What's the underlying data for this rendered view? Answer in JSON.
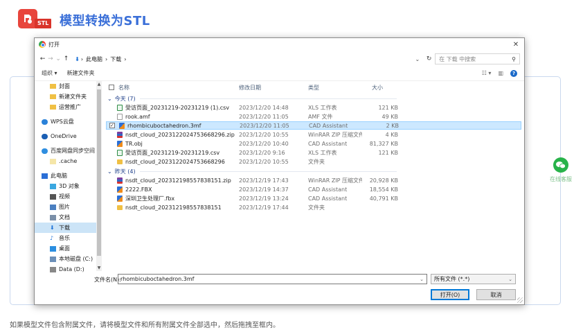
{
  "header": {
    "logo_tag": "STL",
    "title": "模型转换为STL"
  },
  "side_widget": {
    "label": "在线客服"
  },
  "footnote": "如果模型文件包含附属文件，请将模型文件和所有附属文件全部选中，然后拖拽至框内。",
  "dialog": {
    "title": "打开",
    "close": "✕",
    "address": {
      "segments": [
        "此电脑",
        "下载"
      ],
      "sep": "›"
    },
    "search_placeholder": "在 下载 中搜索",
    "toolbar": {
      "organize": "组织 ▾",
      "new_folder": "新建文件夹"
    },
    "nav_items": [
      {
        "label": "封面",
        "icon": "folder",
        "color": "#f0c044"
      },
      {
        "label": "新建文件夹",
        "icon": "folder",
        "color": "#f0c044"
      },
      {
        "label": "运营推广",
        "icon": "folder",
        "color": "#f0c044"
      },
      {
        "label": "WPS云盘",
        "icon": "cloud",
        "color": "#2b82d9",
        "gap": true,
        "indent": true
      },
      {
        "label": "OneDrive",
        "icon": "cloud",
        "color": "#1a5fb4",
        "gap": true,
        "indent": true
      },
      {
        "label": "百度网盘同步空间",
        "icon": "cloud-sync",
        "color": "#2f8ee0",
        "gap": true,
        "indent": true
      },
      {
        "label": ".cache",
        "icon": "file",
        "color": "#f5e6a8"
      },
      {
        "label": "此电脑",
        "icon": "pc",
        "color": "#2b6fd6",
        "gap": true,
        "indent": true
      },
      {
        "label": "3D 对象",
        "icon": "cube",
        "color": "#3aa7e0"
      },
      {
        "label": "视频",
        "icon": "video",
        "color": "#555"
      },
      {
        "label": "图片",
        "icon": "image",
        "color": "#4a7fc0"
      },
      {
        "label": "文档",
        "icon": "doc",
        "color": "#7a8fa8"
      },
      {
        "label": "下载",
        "icon": "download",
        "color": "#1e73d8",
        "selected": true
      },
      {
        "label": "音乐",
        "icon": "music",
        "color": "#1e73d8"
      },
      {
        "label": "桌面",
        "icon": "desktop",
        "color": "#2b8ee0"
      },
      {
        "label": "本地磁盘 (C:)",
        "icon": "drive",
        "color": "#6b8fb8"
      },
      {
        "label": "Data (D:)",
        "icon": "drive",
        "color": "#888"
      }
    ],
    "columns": {
      "name": "名称",
      "date": "修改日期",
      "type": "类型",
      "size": "大小"
    },
    "groups": [
      {
        "label": "今天 (7)",
        "files": [
          {
            "name": "受访页面_20231219-20231219 (1).csv",
            "date": "2023/12/20 14:48",
            "type": "XLS 工作表",
            "size": "121 KB",
            "icon": "csv"
          },
          {
            "name": "rook.amf",
            "date": "2023/12/20 11:05",
            "type": "AMF 文件",
            "size": "49 KB",
            "icon": "file"
          },
          {
            "name": "rhombicuboctahedron.3mf",
            "date": "2023/12/20 11:05",
            "type": "CAD Assistant",
            "size": "2 KB",
            "icon": "cad",
            "selected": true
          },
          {
            "name": "nsdt_cloud_20231220247536682​96.zip",
            "date": "2023/12/20 10:55",
            "type": "WinRAR ZIP 压缩文件",
            "size": "4 KB",
            "icon": "zip"
          },
          {
            "name": "TR.obj",
            "date": "2023/12/20 10:40",
            "type": "CAD Assistant",
            "size": "81,327 KB",
            "icon": "obj"
          },
          {
            "name": "受访页面_20231219-20231219.csv",
            "date": "2023/12/20 9:16",
            "type": "XLS 工作表",
            "size": "121 KB",
            "icon": "csv"
          },
          {
            "name": "nsdt_cloud_20231220247536682​96",
            "date": "2023/12/20 10:55",
            "type": "文件夹",
            "size": "",
            "icon": "folder"
          }
        ]
      },
      {
        "label": "昨天 (4)",
        "files": [
          {
            "name": "nsdt_cloud_202312198557838151.zip",
            "date": "2023/12/19 17:43",
            "type": "WinRAR ZIP 压缩文件",
            "size": "20,928 KB",
            "icon": "zip"
          },
          {
            "name": "2222.FBX",
            "date": "2023/12/19 14:37",
            "type": "CAD Assistant",
            "size": "18,554 KB",
            "icon": "cad"
          },
          {
            "name": "深圳卫生处理厂.fbx",
            "date": "2023/12/19 13:24",
            "type": "CAD Assistant",
            "size": "40,791 KB",
            "icon": "cad"
          },
          {
            "name": "nsdt_cloud_202312198557838151",
            "date": "2023/12/19 17:44",
            "type": "文件夹",
            "size": "",
            "icon": "folder"
          }
        ]
      }
    ],
    "filename_label": "文件名(N):",
    "filename_value": "rhombicuboctahedron.3mf",
    "filter_value": "所有文件 (*.*)",
    "open_button": "打开(O)",
    "cancel_button": "取消"
  }
}
